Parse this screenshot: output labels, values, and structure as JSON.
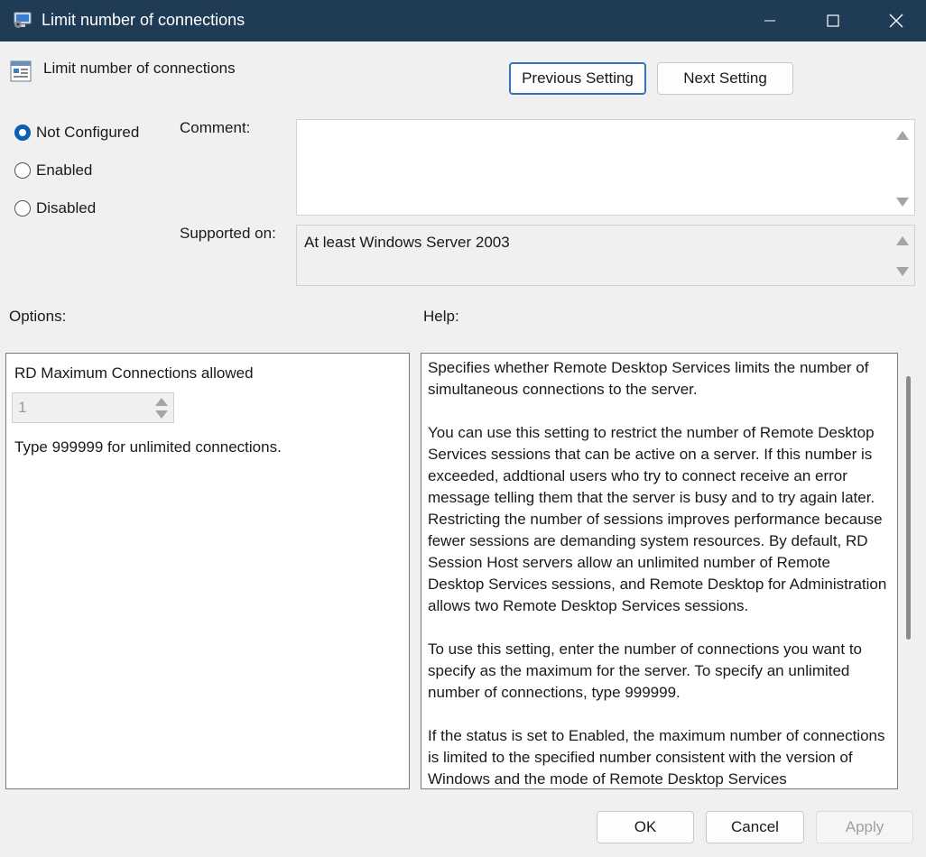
{
  "window": {
    "title": "Limit number of connections"
  },
  "header": {
    "policy_name": "Limit number of connections",
    "previous_label": "Previous Setting",
    "next_label": "Next Setting"
  },
  "state": {
    "options": [
      {
        "label": "Not Configured",
        "checked": true
      },
      {
        "label": "Enabled",
        "checked": false
      },
      {
        "label": "Disabled",
        "checked": false
      }
    ]
  },
  "comment": {
    "label": "Comment:",
    "value": ""
  },
  "supported": {
    "label": "Supported on:",
    "value": "At least Windows Server 2003"
  },
  "options_panel": {
    "label": "Options:",
    "field_label": "RD Maximum Connections allowed",
    "spinner_value": "1",
    "note": "Type 999999 for unlimited connections."
  },
  "help_panel": {
    "label": "Help:",
    "paragraphs": [
      "Specifies whether Remote Desktop Services limits the number of simultaneous connections to the server.",
      "You can use this setting to restrict the number of Remote Desktop Services sessions that can be active on a server. If this number is exceeded, addtional users who try to connect receive an error message telling them that the server is busy and to try again later. Restricting the number of sessions improves performance because fewer sessions are demanding system resources. By default, RD Session Host servers allow an unlimited number of Remote Desktop Services sessions, and Remote Desktop for Administration allows two Remote Desktop Services sessions.",
      "To use this setting, enter the number of connections you want to specify as the maximum for the server. To specify an unlimited number of connections, type 999999.",
      "If the status is set to Enabled, the maximum number of connections is limited to the specified number consistent with the version of Windows and the mode of Remote Desktop Services"
    ]
  },
  "footer": {
    "ok_label": "OK",
    "cancel_label": "Cancel",
    "apply_label": "Apply"
  },
  "colors": {
    "titlebar": "#1f3b56",
    "accent": "#0a5fb4"
  }
}
